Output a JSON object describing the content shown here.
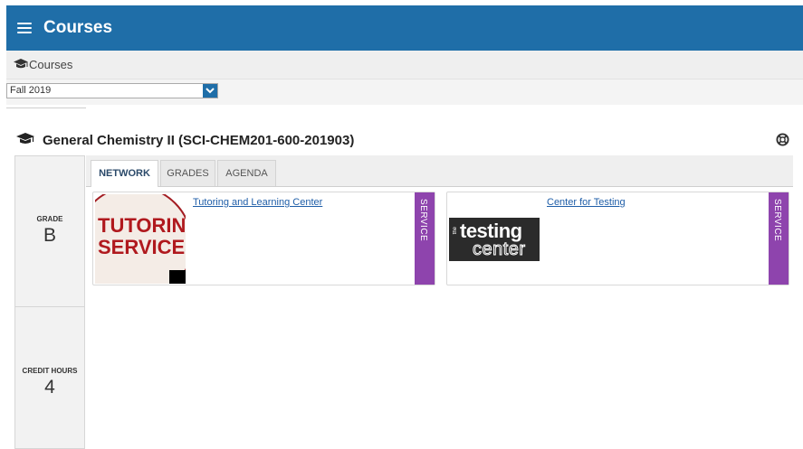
{
  "header": {
    "title": "Courses"
  },
  "breadcrumb": {
    "label": "Courses"
  },
  "term_select": {
    "value": "Fall 2019"
  },
  "course": {
    "title": "General Chemistry II (SCI-CHEM201-600-201903)"
  },
  "stats": {
    "grade": {
      "label": "GRADE",
      "value": "B"
    },
    "credit_hours": {
      "label": "CREDIT HOURS",
      "value": "4"
    }
  },
  "tabs": [
    {
      "label": "NETWORK",
      "active": true
    },
    {
      "label": "GRADES",
      "active": false
    },
    {
      "label": "AGENDA",
      "active": false
    }
  ],
  "cards": [
    {
      "title": "Tutoring and Learning Center",
      "badge": "SERVICE",
      "logo": {
        "line1": "TUTORING",
        "line2": "SERVICES"
      }
    },
    {
      "title": "Center for Testing",
      "badge": "SERVICE",
      "logo": {
        "small": "the",
        "line1": "testing",
        "line2": "center"
      }
    }
  ],
  "colors": {
    "header": "#1f6ea8",
    "service_badge": "#8e44ad",
    "link": "#1f5ea8"
  },
  "icons": {
    "menu": "hamburger-icon",
    "course": "graduation-cap-icon",
    "help": "lifebuoy-icon",
    "dropdown": "chevron-down-icon"
  }
}
